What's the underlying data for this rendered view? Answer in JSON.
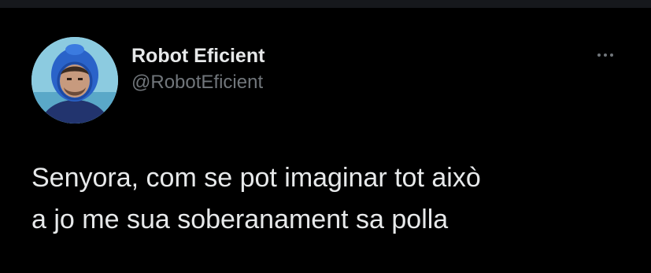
{
  "tweet": {
    "author": {
      "display_name": "Robot Eficient",
      "handle": "@RobotEficient"
    },
    "more_icon": "more-horizontal-icon",
    "text_lines": [
      "Senyora, com se pot imaginar tot això",
      "a jo me sua soberanament sa polla"
    ]
  },
  "colors": {
    "background": "#000000",
    "text_primary": "#e7e9ea",
    "text_secondary": "#71767b"
  }
}
